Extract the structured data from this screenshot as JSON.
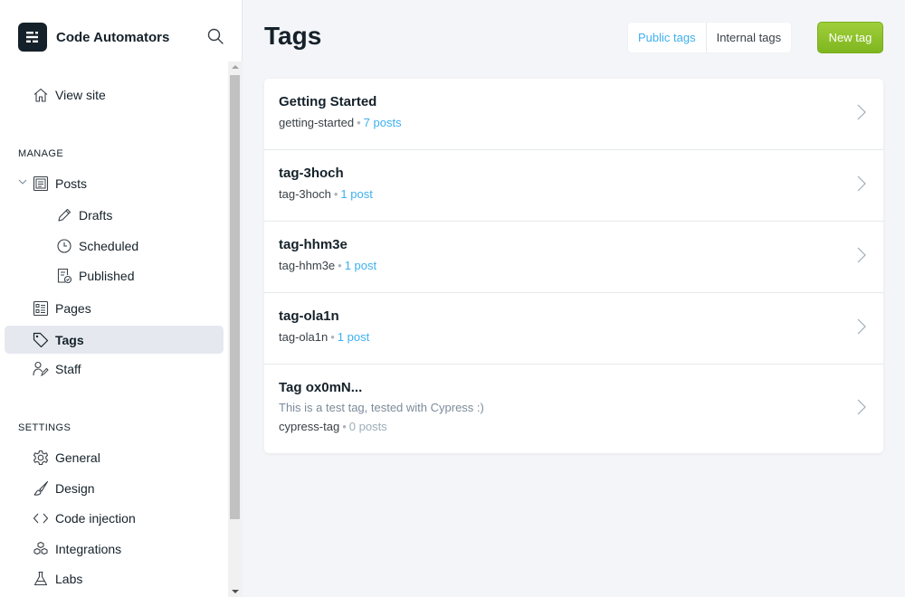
{
  "brand": {
    "name": "Code Automators"
  },
  "sidebar": {
    "view_site": "View site",
    "manage_title": "MANAGE",
    "posts": "Posts",
    "drafts": "Drafts",
    "scheduled": "Scheduled",
    "published": "Published",
    "pages": "Pages",
    "tags": "Tags",
    "staff": "Staff",
    "settings_title": "SETTINGS",
    "general": "General",
    "design": "Design",
    "code_injection": "Code injection",
    "integrations": "Integrations",
    "labs": "Labs"
  },
  "main": {
    "title": "Tags",
    "filters": {
      "public": "Public tags",
      "internal": "Internal tags"
    },
    "new_tag": "New tag",
    "tags": [
      {
        "name": "Getting Started",
        "slug": "getting-started",
        "count": "7 posts"
      },
      {
        "name": "tag-3hoch",
        "slug": "tag-3hoch",
        "count": "1 post"
      },
      {
        "name": "tag-hhm3e",
        "slug": "tag-hhm3e",
        "count": "1 post"
      },
      {
        "name": "tag-ola1n",
        "slug": "tag-ola1n",
        "count": "1 post"
      },
      {
        "name": "Tag ox0mN...",
        "description": "This is a test tag, tested with Cypress :)",
        "slug": "cypress-tag",
        "count": "0 posts"
      }
    ]
  },
  "colors": {
    "accent": "#3eb0ef",
    "primary_button": "#8cc63f",
    "dark": "#15212a"
  }
}
